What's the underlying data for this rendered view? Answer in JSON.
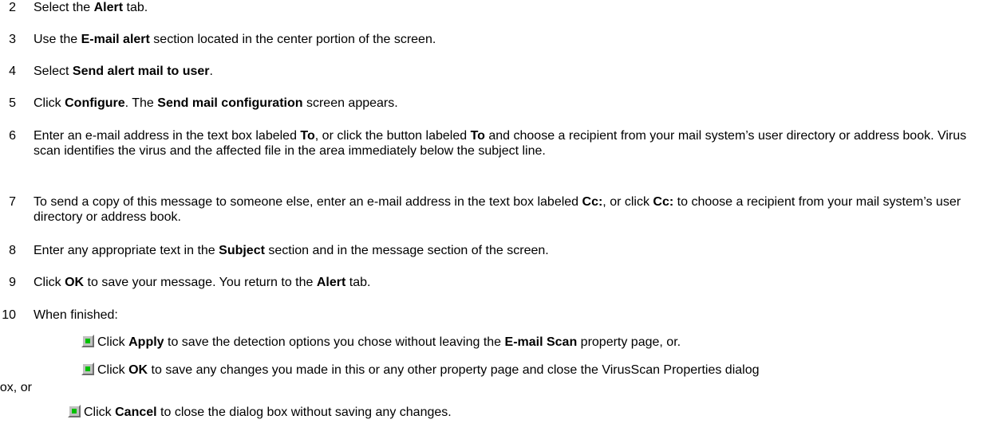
{
  "steps": [
    {
      "num": "2",
      "segments": [
        {
          "t": "Select the "
        },
        {
          "t": "Alert",
          "b": true
        },
        {
          "t": " tab."
        }
      ]
    },
    {
      "num": "3",
      "segments": [
        {
          "t": "Use the "
        },
        {
          "t": "E-mail alert",
          "b": true
        },
        {
          "t": " section located in the center portion of the screen."
        }
      ]
    },
    {
      "num": "4",
      "segments": [
        {
          "t": "Select "
        },
        {
          "t": "Send alert mail to user",
          "b": true
        },
        {
          "t": "."
        }
      ]
    },
    {
      "num": "5",
      "segments": [
        {
          "t": "Click "
        },
        {
          "t": "Configure",
          "b": true
        },
        {
          "t": ". The "
        },
        {
          "t": "Send mail configuration",
          "b": true
        },
        {
          "t": " screen appears."
        }
      ]
    },
    {
      "num": "6",
      "segments": [
        {
          "t": "Enter an e-mail address in the text box labeled "
        },
        {
          "t": "To",
          "b": true
        },
        {
          "t": ", or click the button labeled "
        },
        {
          "t": "To",
          "b": true
        },
        {
          "t": " and choose a recipient from your mail system’s user directory or address book. Virus scan identifies the virus and the affected file in the area immediately below the subject line."
        }
      ]
    },
    {
      "num": "7",
      "segments": [
        {
          "t": "To send a copy of this message to someone else, enter an e-mail address in the text box labeled "
        },
        {
          "t": "Cc:",
          "b": true
        },
        {
          "t": ", or click "
        },
        {
          "t": "Cc:",
          "b": true
        },
        {
          "t": " to choose a recipient from your mail system’s user directory or address book."
        }
      ]
    },
    {
      "num": "8",
      "segments": [
        {
          "t": "Enter any appropriate text in the "
        },
        {
          "t": "Subject",
          "b": true
        },
        {
          "t": " section and in the message section of the screen."
        }
      ]
    },
    {
      "num": "9",
      "segments": [
        {
          "t": "Click "
        },
        {
          "t": "OK",
          "b": true
        },
        {
          "t": " to save your message. You return to the "
        },
        {
          "t": "Alert",
          "b": true
        },
        {
          "t": " tab."
        }
      ]
    },
    {
      "num": "10",
      "segments": [
        {
          "t": "When finished:"
        }
      ]
    }
  ],
  "bullets": [
    {
      "segments": [
        {
          "t": "Click "
        },
        {
          "t": "Apply",
          "b": true
        },
        {
          "t": " to save the detection options you chose without leaving the "
        },
        {
          "t": "E-mail Scan",
          "b": true
        },
        {
          "t": " property page, or."
        }
      ]
    },
    {
      "segments": [
        {
          "t": "Click "
        },
        {
          "t": "OK",
          "b": true
        },
        {
          "t": " to save any changes you made in this or any other property page and close the VirusScan Properties dialog"
        }
      ],
      "continuation": "box, or"
    },
    {
      "segments": [
        {
          "t": "Click "
        },
        {
          "t": "Cancel",
          "b": true
        },
        {
          "t": " to close the dialog box without saving any changes."
        }
      ]
    }
  ],
  "bullet_icon": "green-square-bullet-icon"
}
